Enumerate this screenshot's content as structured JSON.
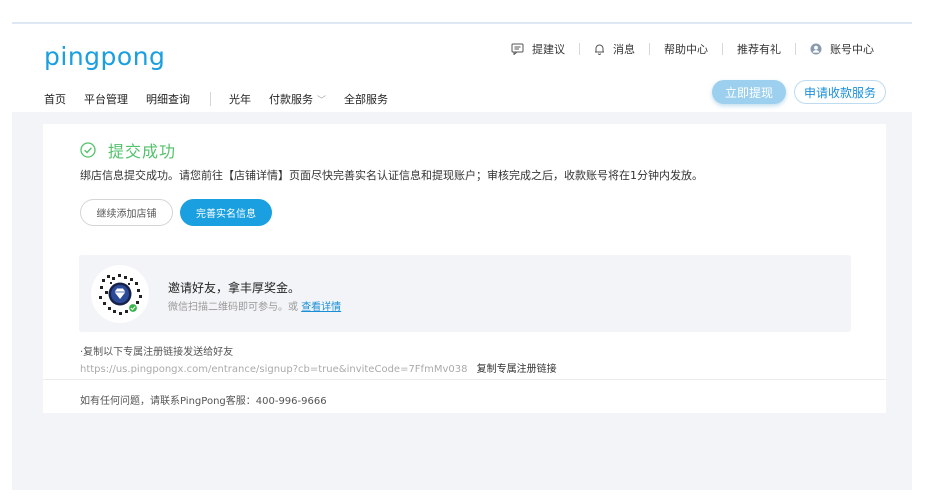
{
  "brand": {
    "logo": "pingpong"
  },
  "top_nav": {
    "suggest": "提建议",
    "messages": "消息",
    "help": "帮助中心",
    "referral": "推荐有礼",
    "account": "账号中心"
  },
  "main_nav": {
    "items": [
      "首页",
      "平台管理",
      "明细查询",
      "光年",
      "付款服务",
      "全部服务"
    ]
  },
  "actions": {
    "withdraw": "立即提现",
    "apply": "申请收款服务"
  },
  "success": {
    "title": "提交成功",
    "description": "绑店信息提交成功。请您前往【店铺详情】页面尽快完善实名认证信息和提现账户；审核完成之后，收款账号将在1分钟内发放。",
    "continue_button": "继续添加店铺",
    "complete_button": "完善实名信息"
  },
  "invite": {
    "title": "邀请好友，拿丰厚奖金。",
    "subtitle": "微信扫描二维码即可参与。或",
    "link": "查看详情"
  },
  "copy": {
    "label": "·复制以下专属注册链接发送给好友",
    "url": "https://us.pingpongx.com/entrance/signup?cb=true&inviteCode=7FfmMv038",
    "button": "复制专属注册链接"
  },
  "contact": {
    "text": "如有任何问题，请联系PingPong客服：400-996-9666"
  },
  "colors": {
    "brand": "#1a9fe0",
    "success": "#52c26b",
    "link": "#1a8fd8"
  }
}
